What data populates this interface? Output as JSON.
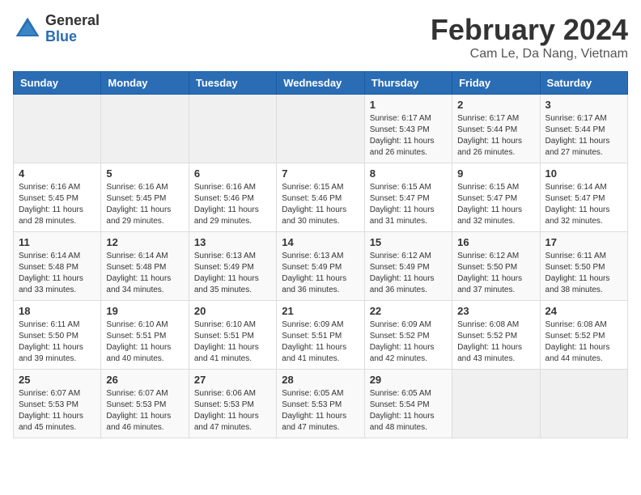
{
  "header": {
    "logo_general": "General",
    "logo_blue": "Blue",
    "title": "February 2024",
    "subtitle": "Cam Le, Da Nang, Vietnam"
  },
  "weekdays": [
    "Sunday",
    "Monday",
    "Tuesday",
    "Wednesday",
    "Thursday",
    "Friday",
    "Saturday"
  ],
  "weeks": [
    [
      {
        "day": "",
        "info": ""
      },
      {
        "day": "",
        "info": ""
      },
      {
        "day": "",
        "info": ""
      },
      {
        "day": "",
        "info": ""
      },
      {
        "day": "1",
        "info": "Sunrise: 6:17 AM\nSunset: 5:43 PM\nDaylight: 11 hours and 26 minutes."
      },
      {
        "day": "2",
        "info": "Sunrise: 6:17 AM\nSunset: 5:44 PM\nDaylight: 11 hours and 26 minutes."
      },
      {
        "day": "3",
        "info": "Sunrise: 6:17 AM\nSunset: 5:44 PM\nDaylight: 11 hours and 27 minutes."
      }
    ],
    [
      {
        "day": "4",
        "info": "Sunrise: 6:16 AM\nSunset: 5:45 PM\nDaylight: 11 hours and 28 minutes."
      },
      {
        "day": "5",
        "info": "Sunrise: 6:16 AM\nSunset: 5:45 PM\nDaylight: 11 hours and 29 minutes."
      },
      {
        "day": "6",
        "info": "Sunrise: 6:16 AM\nSunset: 5:46 PM\nDaylight: 11 hours and 29 minutes."
      },
      {
        "day": "7",
        "info": "Sunrise: 6:15 AM\nSunset: 5:46 PM\nDaylight: 11 hours and 30 minutes."
      },
      {
        "day": "8",
        "info": "Sunrise: 6:15 AM\nSunset: 5:47 PM\nDaylight: 11 hours and 31 minutes."
      },
      {
        "day": "9",
        "info": "Sunrise: 6:15 AM\nSunset: 5:47 PM\nDaylight: 11 hours and 32 minutes."
      },
      {
        "day": "10",
        "info": "Sunrise: 6:14 AM\nSunset: 5:47 PM\nDaylight: 11 hours and 32 minutes."
      }
    ],
    [
      {
        "day": "11",
        "info": "Sunrise: 6:14 AM\nSunset: 5:48 PM\nDaylight: 11 hours and 33 minutes."
      },
      {
        "day": "12",
        "info": "Sunrise: 6:14 AM\nSunset: 5:48 PM\nDaylight: 11 hours and 34 minutes."
      },
      {
        "day": "13",
        "info": "Sunrise: 6:13 AM\nSunset: 5:49 PM\nDaylight: 11 hours and 35 minutes."
      },
      {
        "day": "14",
        "info": "Sunrise: 6:13 AM\nSunset: 5:49 PM\nDaylight: 11 hours and 36 minutes."
      },
      {
        "day": "15",
        "info": "Sunrise: 6:12 AM\nSunset: 5:49 PM\nDaylight: 11 hours and 36 minutes."
      },
      {
        "day": "16",
        "info": "Sunrise: 6:12 AM\nSunset: 5:50 PM\nDaylight: 11 hours and 37 minutes."
      },
      {
        "day": "17",
        "info": "Sunrise: 6:11 AM\nSunset: 5:50 PM\nDaylight: 11 hours and 38 minutes."
      }
    ],
    [
      {
        "day": "18",
        "info": "Sunrise: 6:11 AM\nSunset: 5:50 PM\nDaylight: 11 hours and 39 minutes."
      },
      {
        "day": "19",
        "info": "Sunrise: 6:10 AM\nSunset: 5:51 PM\nDaylight: 11 hours and 40 minutes."
      },
      {
        "day": "20",
        "info": "Sunrise: 6:10 AM\nSunset: 5:51 PM\nDaylight: 11 hours and 41 minutes."
      },
      {
        "day": "21",
        "info": "Sunrise: 6:09 AM\nSunset: 5:51 PM\nDaylight: 11 hours and 41 minutes."
      },
      {
        "day": "22",
        "info": "Sunrise: 6:09 AM\nSunset: 5:52 PM\nDaylight: 11 hours and 42 minutes."
      },
      {
        "day": "23",
        "info": "Sunrise: 6:08 AM\nSunset: 5:52 PM\nDaylight: 11 hours and 43 minutes."
      },
      {
        "day": "24",
        "info": "Sunrise: 6:08 AM\nSunset: 5:52 PM\nDaylight: 11 hours and 44 minutes."
      }
    ],
    [
      {
        "day": "25",
        "info": "Sunrise: 6:07 AM\nSunset: 5:53 PM\nDaylight: 11 hours and 45 minutes."
      },
      {
        "day": "26",
        "info": "Sunrise: 6:07 AM\nSunset: 5:53 PM\nDaylight: 11 hours and 46 minutes."
      },
      {
        "day": "27",
        "info": "Sunrise: 6:06 AM\nSunset: 5:53 PM\nDaylight: 11 hours and 47 minutes."
      },
      {
        "day": "28",
        "info": "Sunrise: 6:05 AM\nSunset: 5:53 PM\nDaylight: 11 hours and 47 minutes."
      },
      {
        "day": "29",
        "info": "Sunrise: 6:05 AM\nSunset: 5:54 PM\nDaylight: 11 hours and 48 minutes."
      },
      {
        "day": "",
        "info": ""
      },
      {
        "day": "",
        "info": ""
      }
    ]
  ]
}
